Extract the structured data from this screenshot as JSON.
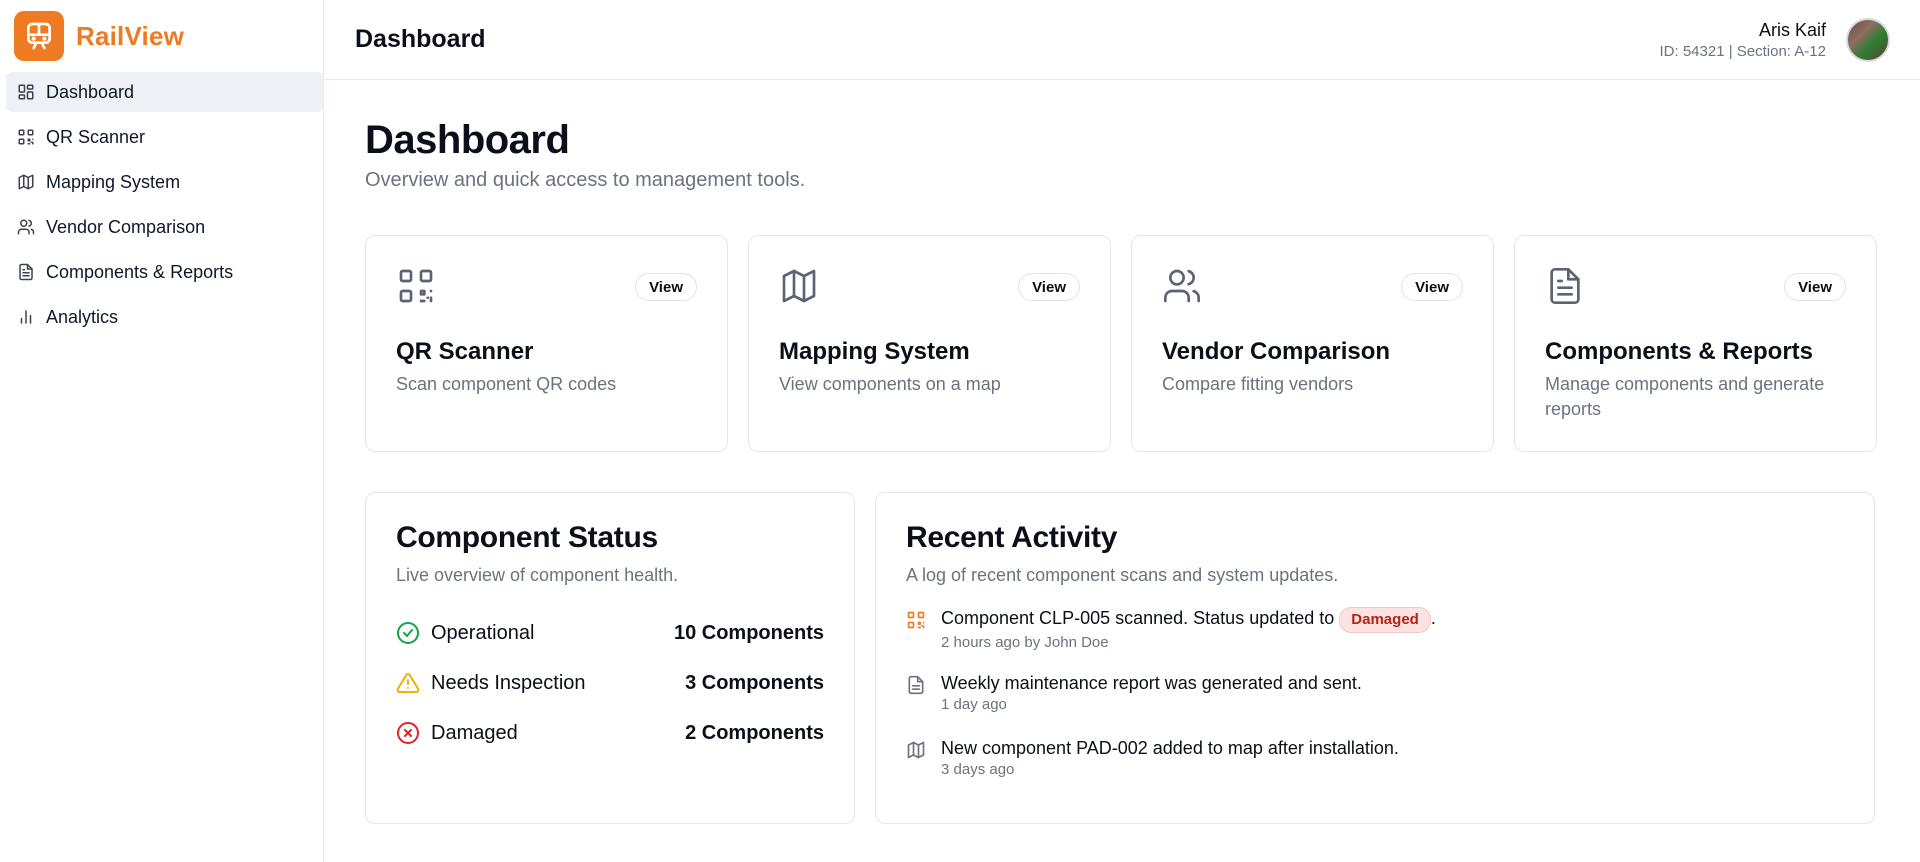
{
  "brand": {
    "name": "RailView",
    "accent": "#f07a22"
  },
  "sidebar": {
    "items": [
      {
        "label": "Dashboard",
        "icon": "layout-grid-icon",
        "active": true
      },
      {
        "label": "QR Scanner",
        "icon": "qr-code-icon",
        "active": false
      },
      {
        "label": "Mapping System",
        "icon": "map-icon",
        "active": false
      },
      {
        "label": "Vendor Comparison",
        "icon": "users-icon",
        "active": false
      },
      {
        "label": "Components & Reports",
        "icon": "file-text-icon",
        "active": false
      },
      {
        "label": "Analytics",
        "icon": "bar-chart-icon",
        "active": false
      }
    ]
  },
  "header": {
    "title": "Dashboard",
    "user": {
      "name": "Aris Kaif",
      "meta": "ID: 54321 | Section: A-12"
    }
  },
  "main": {
    "title": "Dashboard",
    "subtitle": "Overview and quick access to management tools.",
    "cards": [
      {
        "title": "QR Scanner",
        "desc": "Scan component QR codes",
        "button": "View",
        "icon": "qr-code-icon"
      },
      {
        "title": "Mapping System",
        "desc": "View components on a map",
        "button": "View",
        "icon": "map-icon"
      },
      {
        "title": "Vendor Comparison",
        "desc": "Compare fitting vendors",
        "button": "View",
        "icon": "users-icon"
      },
      {
        "title": "Components & Reports",
        "desc": "Manage components and generate reports",
        "button": "View",
        "icon": "file-text-icon"
      }
    ],
    "status": {
      "title": "Component Status",
      "subtitle": "Live overview of component health.",
      "rows": [
        {
          "label": "Operational",
          "count": "10 Components",
          "icon": "check-circle-icon",
          "color": "#16a34a"
        },
        {
          "label": "Needs Inspection",
          "count": "3 Components",
          "icon": "warning-triangle-icon",
          "color": "#eab308"
        },
        {
          "label": "Damaged",
          "count": "2 Components",
          "icon": "x-circle-icon",
          "color": "#dc2626"
        }
      ]
    },
    "activity": {
      "title": "Recent Activity",
      "subtitle": "A log of recent component scans and system updates.",
      "items": [
        {
          "text": "Component CLP-005 scanned. Status updated to",
          "badge": "Damaged",
          "suffix": ".",
          "time": "2 hours ago by John Doe",
          "icon": "qr-code-icon"
        },
        {
          "text": "Weekly maintenance report was generated and sent.",
          "time": "1 day ago",
          "icon": "file-text-icon"
        },
        {
          "text": "New component PAD-002 added to map after installation.",
          "time": "3 days ago",
          "icon": "map-icon"
        }
      ]
    }
  }
}
